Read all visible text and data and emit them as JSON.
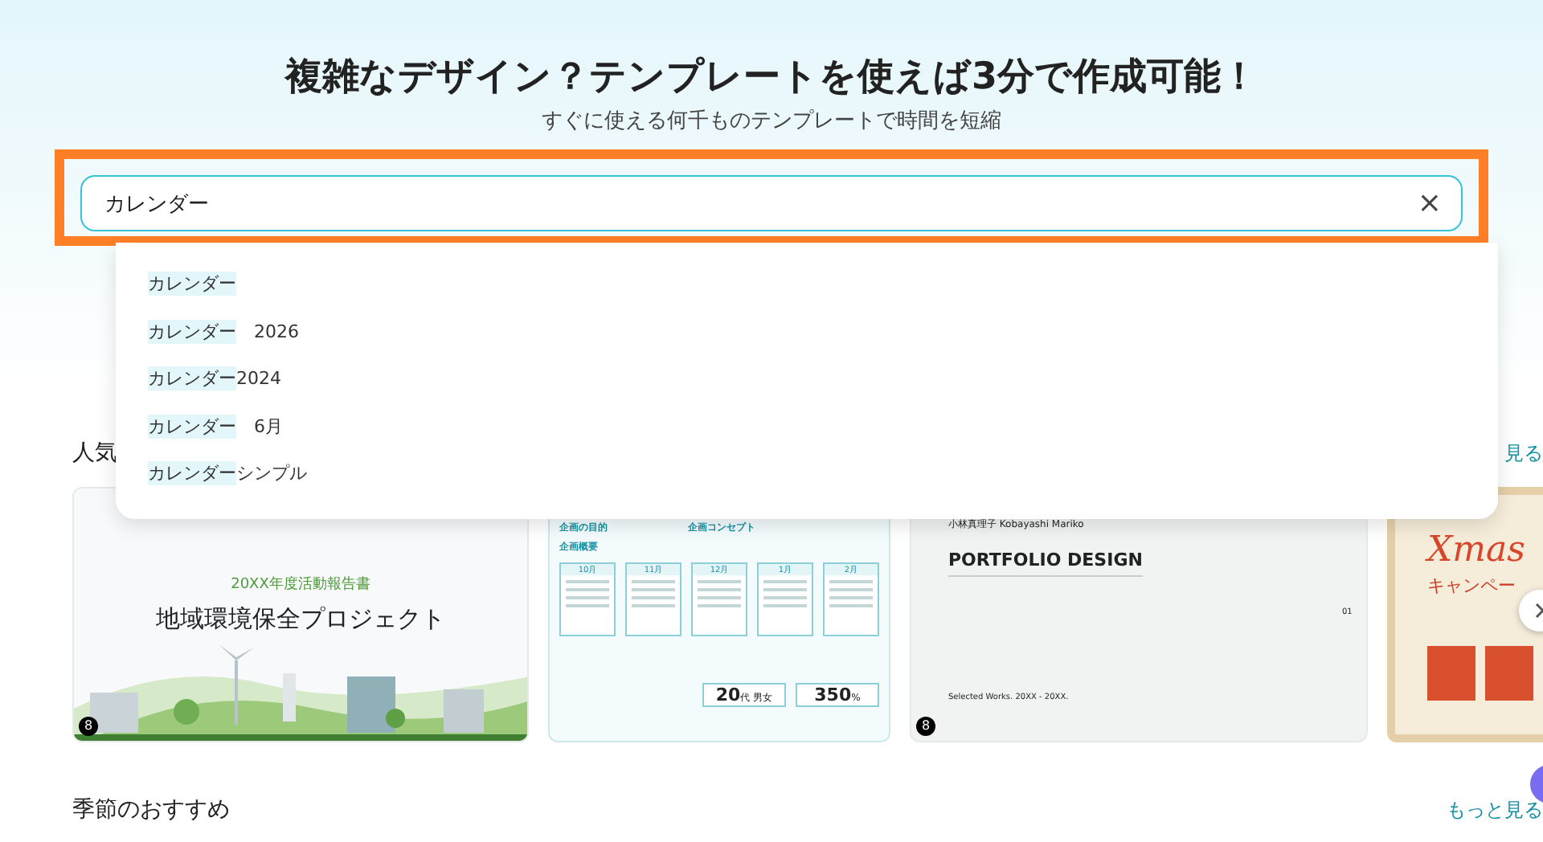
{
  "hero": {
    "title": "複雑なデザイン？テンプレートを使えば3分で作成可能！",
    "subtitle": "すぐに使える何千ものテンプレートで時間を短縮"
  },
  "search": {
    "value": "カレンダー",
    "clear": "×"
  },
  "suggestions": [
    {
      "match": "カレンダー"
    },
    {
      "match": "カレンダー",
      "rest": "　2026"
    },
    {
      "match": "カレンダー",
      "rest": "2024"
    },
    {
      "match": "カレンダー",
      "rest": "　6月"
    },
    {
      "match": "カレンダー",
      "rest": "シンプル"
    }
  ],
  "sections": [
    {
      "title": "人気",
      "more": "見る",
      "cards": [
        {
          "kind": "report",
          "badge": "8",
          "subtitle": "20XX年度活動報告書",
          "title": "地域環境保全プロジェクト"
        },
        {
          "kind": "plan",
          "headings": [
            "企画の目的",
            "企画コンセプト",
            "企画概要"
          ],
          "months": [
            "10月",
            "11月",
            "12月",
            "1月",
            "2月"
          ],
          "stats": [
            {
              "value": "20",
              "unit": "代 男女"
            },
            {
              "value": "350",
              "unit": "%"
            }
          ]
        },
        {
          "kind": "portfolio",
          "badge": "8",
          "author": "小林真理子 Kobayashi Mariko",
          "title": "PORTFOLIO DESIGN",
          "page": "01",
          "footer": "Selected Works. 20XX - 20XX."
        },
        {
          "kind": "xmas",
          "title": "Xmas",
          "subtitle": "キャンペー"
        }
      ]
    },
    {
      "title": "季節のおすすめ",
      "more": "もっと見る"
    }
  ]
}
